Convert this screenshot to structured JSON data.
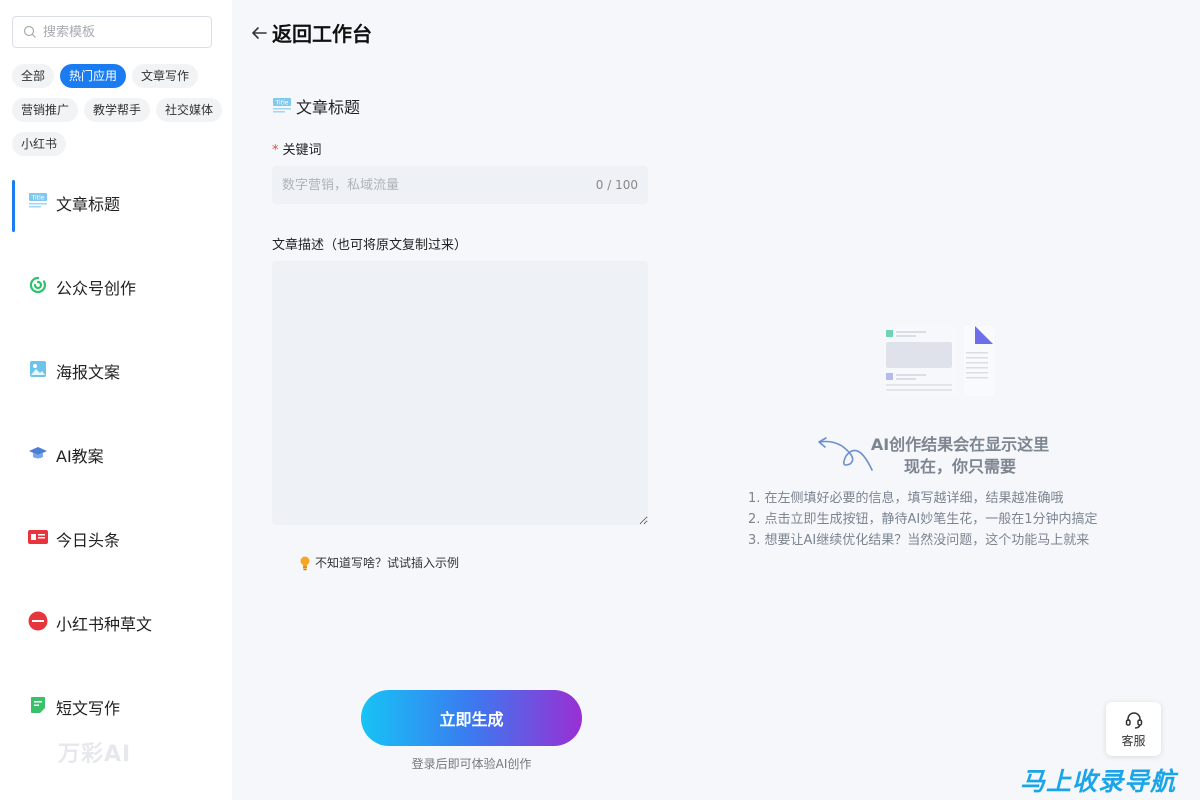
{
  "sidebar": {
    "search_placeholder": "搜索模板",
    "filters": [
      "全部",
      "热门应用",
      "文章写作",
      "营销推广",
      "教学帮手",
      "社交媒体",
      "小红书"
    ],
    "active_filter": "热门应用",
    "items": [
      {
        "label": "文章标题",
        "icon": "title-template-icon",
        "active": true
      },
      {
        "label": "公众号创作",
        "icon": "wechat-official-icon"
      },
      {
        "label": "海报文案",
        "icon": "poster-image-icon"
      },
      {
        "label": "AI教案",
        "icon": "graduation-cap-icon"
      },
      {
        "label": "今日头条",
        "icon": "toutiao-logo-icon"
      },
      {
        "label": "小红书种草文",
        "icon": "xiaohongshu-logo-icon"
      },
      {
        "label": "短文写作",
        "icon": "note-document-icon"
      }
    ],
    "watermark": "万彩AI"
  },
  "header": {
    "back_label": "返回工作台"
  },
  "form": {
    "title": "文章标题",
    "keyword_label": "关键词",
    "keyword_placeholder": "数字营销，私域流量",
    "keyword_count": "0 / 100",
    "desc_label": "文章描述（也可将原文复制过来）",
    "desc_value": "",
    "example_link": "不知道写啥？试试插入示例",
    "generate_button": "立即生成",
    "generate_hint": "登录后即可体验AI创作"
  },
  "result": {
    "title_line1": "AI创作结果会在显示这里",
    "title_line2": "现在，你只需要",
    "tips": [
      "1. 在左侧填好必要的信息，填写越详细，结果越准确哦",
      "2. 点击立即生成按钮，静待AI妙笔生花，一般在1分钟内搞定",
      "3. 想要让AI继续优化结果？当然没问题，这个功能马上就来"
    ]
  },
  "service": {
    "label": "客服"
  },
  "brand": {
    "logo_text": "马上收录导航"
  },
  "colors": {
    "accent": "#1a7cf0",
    "button_gradient": [
      "#17c3f5",
      "#3b7af0",
      "#9a2fd3"
    ],
    "required_mark": "#e84c3d"
  }
}
